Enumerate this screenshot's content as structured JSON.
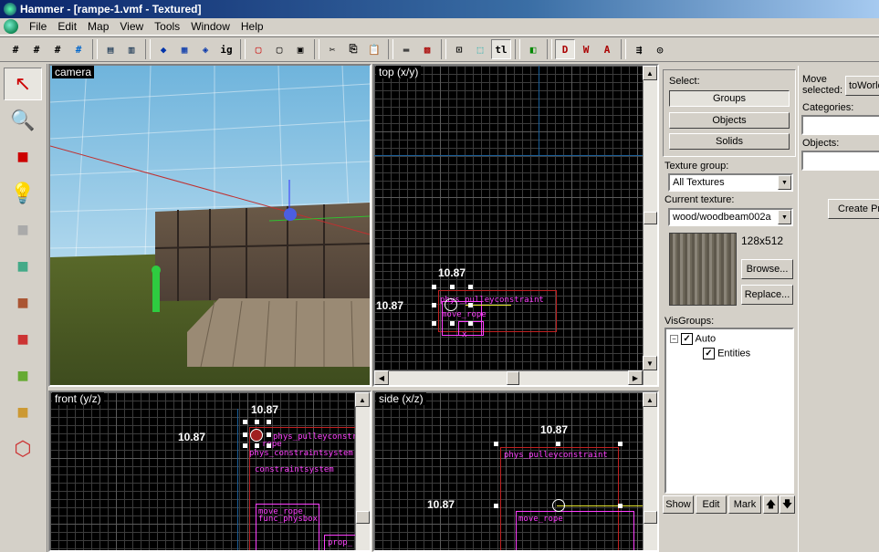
{
  "window": {
    "title": "Hammer - [rampe-1.vmf - Textured]"
  },
  "menu": [
    "File",
    "Edit",
    "Map",
    "View",
    "Tools",
    "Window",
    "Help"
  ],
  "viewports": {
    "camera": {
      "label": "camera"
    },
    "top": {
      "label": "top (x/y)",
      "dim_h": "10.87",
      "dim_v": "10.87",
      "entities": [
        "phys_pulleyconstraint",
        "move_rope",
        "x"
      ]
    },
    "front": {
      "label": "front (y/z)",
      "dim_h": "10.87",
      "dim_v": "10.87",
      "entities": [
        "phys_pulleyconstraint",
        "rope",
        "phys_constraintsystem",
        "constraintsystem",
        "move_rope",
        "func_physbox",
        "prop_"
      ]
    },
    "side": {
      "label": "side (x/z)",
      "dim_h": "10.87",
      "dim_v": "10.87",
      "entities": [
        "phys_pulleyconstraint",
        "move_rope"
      ]
    }
  },
  "panel": {
    "select_label": "Select:",
    "select_buttons": [
      "Groups",
      "Objects",
      "Solids"
    ],
    "texture_group_label": "Texture group:",
    "texture_group_value": "All Textures",
    "current_texture_label": "Current texture:",
    "current_texture_value": "wood/woodbeam002a",
    "texture_size": "128x512",
    "browse_label": "Browse...",
    "replace_label": "Replace...",
    "visgroups_label": "VisGroups:",
    "visgroups": [
      {
        "name": "Auto",
        "checked": true
      },
      {
        "name": "Entities",
        "checked": true
      }
    ],
    "show_label": "Show",
    "edit_label": "Edit",
    "mark_label": "Mark"
  },
  "farright": {
    "move_selected_label": "Move selected:",
    "to_world_label": "toWorld",
    "categories_label": "Categories:",
    "objects_label": "Objects:",
    "create_prefab_label": "Create Pr"
  }
}
